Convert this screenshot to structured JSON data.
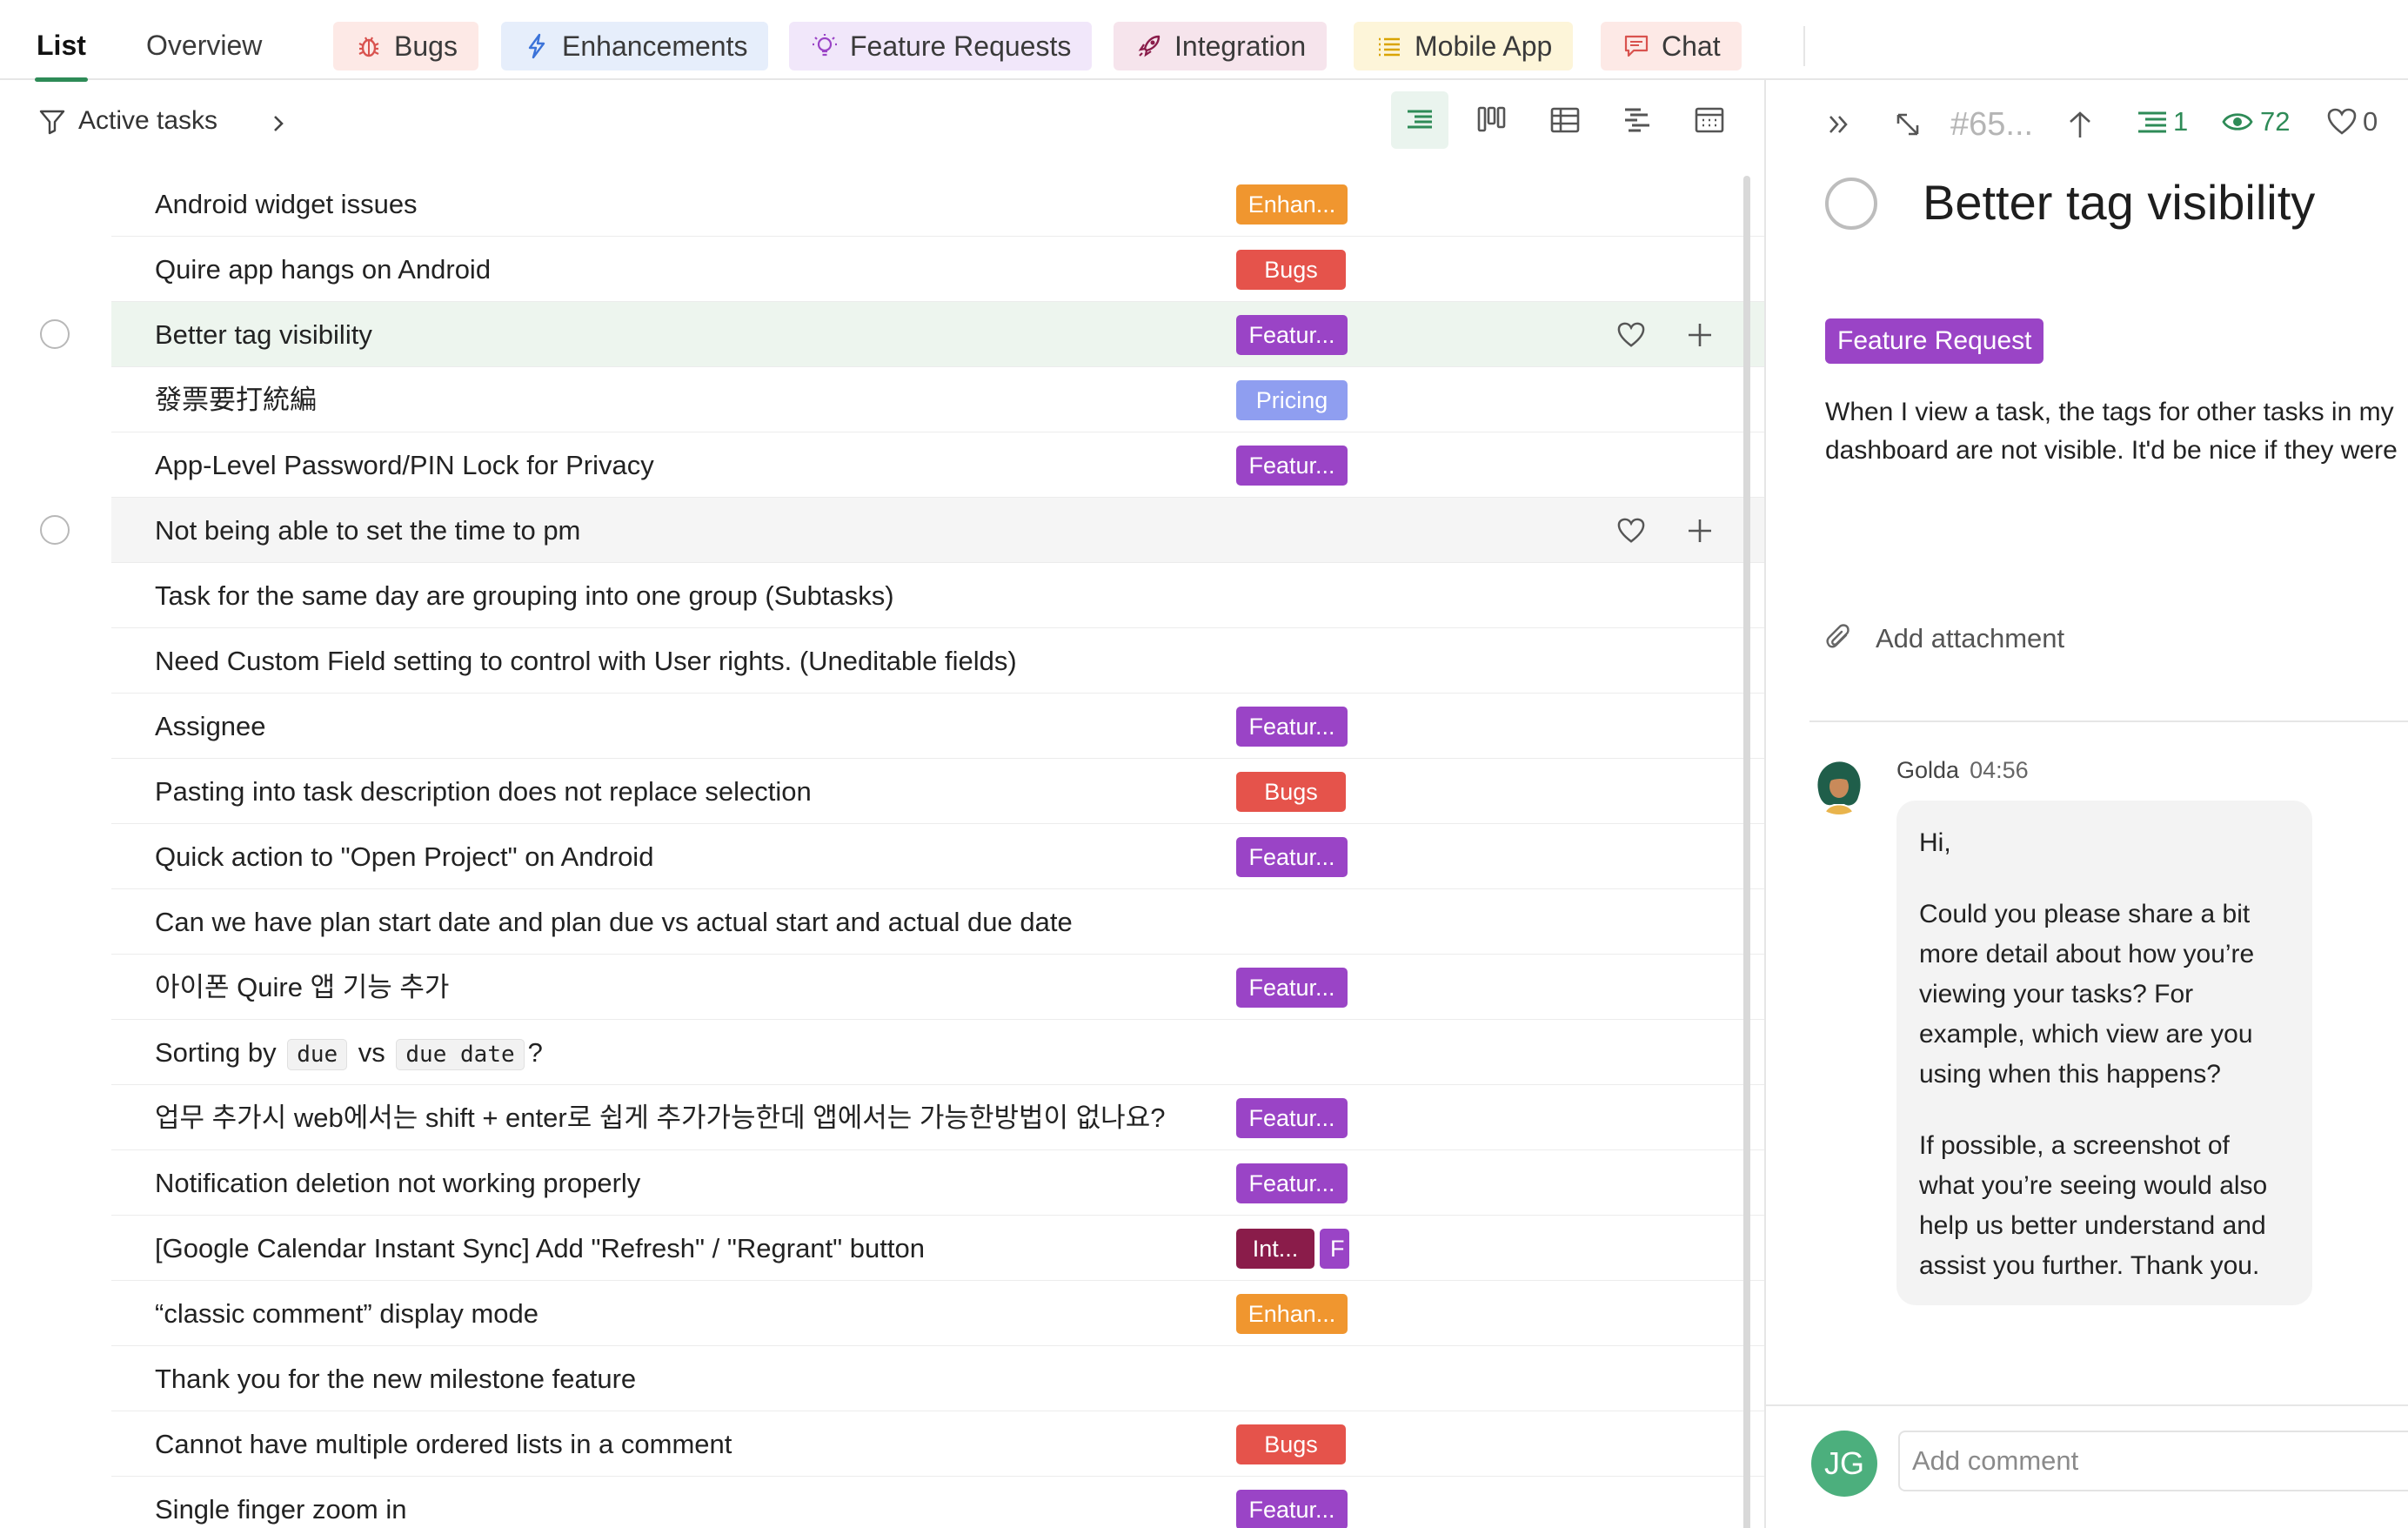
{
  "topbar": {
    "tabs": [
      {
        "label": "List",
        "active": true
      },
      {
        "label": "Overview",
        "active": false
      }
    ],
    "chips": [
      {
        "label": "Bugs",
        "icon": "bug-icon",
        "bg": "#fde9e6"
      },
      {
        "label": "Enhancements",
        "icon": "lightning-icon",
        "bg": "#e6eefb"
      },
      {
        "label": "Feature Requests",
        "icon": "lightbulb-icon",
        "bg": "#f1e7fa"
      },
      {
        "label": "Integration",
        "icon": "rocket-icon",
        "bg": "#f6e4ec"
      },
      {
        "label": "Mobile App",
        "icon": "list-icon",
        "bg": "#fdf5d9"
      },
      {
        "label": "Chat",
        "icon": "chat-icon",
        "bg": "#fde9e6"
      }
    ]
  },
  "filter": {
    "label": "Active tasks"
  },
  "colors": {
    "accent": "#2e8b57",
    "enhancement": "#f0962f",
    "bugs": "#e5534b",
    "feature": "#9a44c6",
    "pricing": "#8f9ef0",
    "integration": "#8a1c4a"
  },
  "tasks": [
    {
      "title": "Android widget issues",
      "tags": [
        {
          "label": "Enhan...",
          "color": "#f0962f"
        }
      ]
    },
    {
      "title": "Quire app hangs on Android",
      "tags": [
        {
          "label": "Bugs",
          "color": "#e5534b"
        }
      ]
    },
    {
      "title": "Better tag visibility",
      "tags": [
        {
          "label": "Featur...",
          "color": "#9a44c6"
        }
      ],
      "selected": true
    },
    {
      "title": "發票要打統編",
      "tags": [
        {
          "label": "Pricing",
          "color": "#8f9ef0"
        }
      ]
    },
    {
      "title": "App-Level Password/PIN Lock for Privacy",
      "tags": [
        {
          "label": "Featur...",
          "color": "#9a44c6"
        }
      ]
    },
    {
      "title": "Not being able to set the time to pm",
      "tags": [],
      "hover": true
    },
    {
      "title": "Task for the same day are grouping into one group (Subtasks)",
      "tags": []
    },
    {
      "title": "Need Custom Field setting to control with User rights. (Uneditable fields)",
      "tags": []
    },
    {
      "title": "Assignee",
      "tags": [
        {
          "label": "Featur...",
          "color": "#9a44c6"
        }
      ]
    },
    {
      "title": "Pasting into task description does not replace selection",
      "tags": [
        {
          "label": "Bugs",
          "color": "#e5534b"
        }
      ]
    },
    {
      "title": "Quick action to \"Open Project\" on Android",
      "tags": [
        {
          "label": "Featur...",
          "color": "#9a44c6"
        }
      ]
    },
    {
      "title": "Can we have plan start date and plan due vs actual start and actual due date",
      "tags": []
    },
    {
      "title": "아이폰 Quire 앱 기능 추가",
      "tags": [
        {
          "label": "Featur...",
          "color": "#9a44c6"
        }
      ]
    },
    {
      "title_parts": {
        "pre": "Sorting by",
        "code1": "due",
        "mid": "vs",
        "code2": "due date",
        "post": "?"
      },
      "tags": []
    },
    {
      "title": "업무 추가시 web에서는 shift + enter로 쉽게 추가가능한데 앱에서는 가능한방법이 없나요?",
      "tags": [
        {
          "label": "Featur...",
          "color": "#9a44c6"
        }
      ]
    },
    {
      "title": "Notification deletion not working properly",
      "tags": [
        {
          "label": "Featur...",
          "color": "#9a44c6"
        }
      ]
    },
    {
      "title": "[Google Calendar Instant Sync] Add \"Refresh\" / \"Regrant\" button",
      "tags": [
        {
          "label": "Int...",
          "color": "#8a1c4a"
        },
        {
          "label": "F",
          "color": "#9a44c6"
        }
      ]
    },
    {
      "title": "“classic comment” display mode",
      "tags": [
        {
          "label": "Enhan...",
          "color": "#f0962f"
        }
      ]
    },
    {
      "title": "Thank you for the new milestone feature",
      "tags": []
    },
    {
      "title": "Cannot have multiple ordered lists in a comment",
      "tags": [
        {
          "label": "Bugs",
          "color": "#e5534b"
        }
      ]
    },
    {
      "title": "Single finger zoom in",
      "tags": [
        {
          "label": "Featur...",
          "color": "#9a44c6"
        }
      ]
    }
  ],
  "detail": {
    "id": "#65...",
    "subtasks": "1",
    "views": "72",
    "likes": "0",
    "title": "Better tag visibility",
    "tag": "Feature Request",
    "description": "When I view a task, the tags for other tasks in my dashboard are not visible. It'd be nice if they were",
    "attachment_label": "Add attachment",
    "comment": {
      "author": "Golda",
      "time": "04:56",
      "paragraphs": [
        "Hi,",
        "Could you please share a bit more detail about how you’re viewing your tasks? For example, which view are you using when this happens?",
        "If possible, a screenshot of what you’re seeing would also help us better understand and assist you further. Thank you."
      ]
    },
    "user_initials": "JG",
    "comment_placeholder": "Add comment"
  }
}
